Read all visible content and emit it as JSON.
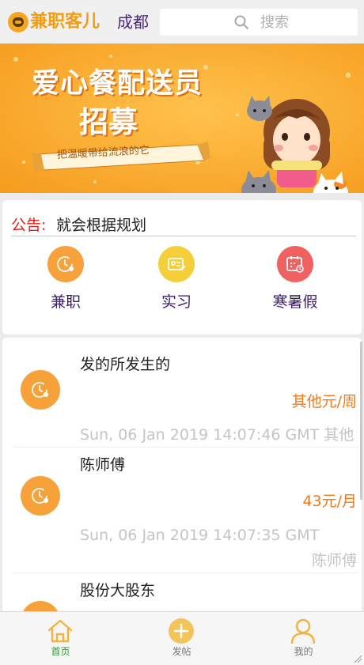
{
  "header": {
    "brand": "兼职客儿",
    "city": "成都",
    "search_placeholder": "搜索",
    "brand_color": "#f39c12"
  },
  "banner": {
    "headline_line1": "爱心餐配送员",
    "headline_line2": "招募",
    "ribbon_text": "把温暖带给流浪的它",
    "background_color": "#fbb03b"
  },
  "notice": {
    "label": "公告:",
    "text": "就会根据规划"
  },
  "categories": [
    {
      "label": "兼职",
      "icon": "clock-icon",
      "color": "#f7a13a"
    },
    {
      "label": "实习",
      "icon": "id-card-icon",
      "color": "#f5cf3a"
    },
    {
      "label": "寒暑假",
      "icon": "calendar-icon",
      "color": "#f06262"
    }
  ],
  "jobs": [
    {
      "title": "发的所发生的",
      "price": "其他元/周",
      "meta": "Sun, 06 Jan 2019 14:07:46 GMT 其他"
    },
    {
      "title": "陈师傅",
      "price": "43元/月",
      "meta": "Sun, 06 Jan 2019 14:07:35 GMT",
      "meta2": "陈师傅"
    },
    {
      "title": "股份大股东"
    }
  ],
  "tabbar": {
    "tabs": [
      {
        "label": "首页",
        "icon": "home-icon",
        "active": true
      },
      {
        "label": "发帖",
        "icon": "plus-circle-icon",
        "active": false
      },
      {
        "label": "我的",
        "icon": "user-icon",
        "active": false
      }
    ],
    "active_color": "#2a9d2a",
    "icon_color": "#f2b33d"
  }
}
